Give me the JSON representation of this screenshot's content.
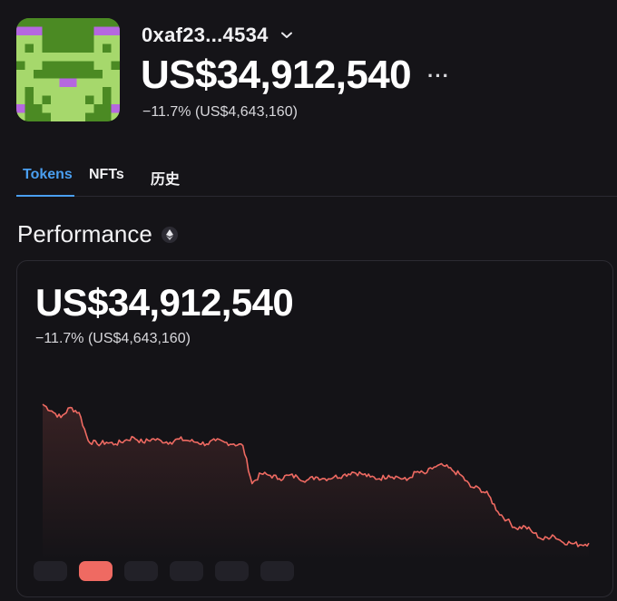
{
  "account": {
    "name": "0xaf23...4534",
    "balance": "US$34,912,540",
    "change": "−11.7% (US$4,643,160)",
    "more_label": "···"
  },
  "tabs": [
    {
      "label": "Tokens",
      "active": true
    },
    {
      "label": "NFTs",
      "active": false
    },
    {
      "label": "历史",
      "active": false
    }
  ],
  "performance": {
    "title": "Performance",
    "value": "US$34,912,540",
    "change": "−11.7% (US$4,643,160)",
    "range_buttons": [
      {
        "active": false
      },
      {
        "active": true
      },
      {
        "active": false
      },
      {
        "active": false
      },
      {
        "active": false
      },
      {
        "active": false
      }
    ]
  },
  "colors": {
    "accent": "#4a9ff0",
    "line": "#ef6a62",
    "background": "#151418",
    "avatar_green": "#4b8a23",
    "avatar_light": "#a6d86c",
    "avatar_purple": "#b567e0"
  },
  "icons": {
    "account_dropdown": "chevron-down-icon",
    "more": "more-icon",
    "network": "ethereum-icon"
  },
  "chart_data": {
    "type": "area",
    "y_unit": "relative",
    "x": [
      0,
      1,
      2,
      3,
      4,
      5,
      6,
      7,
      8,
      9,
      10,
      11,
      12,
      13,
      14,
      15,
      16,
      17,
      18,
      19,
      20,
      21,
      22,
      23,
      24,
      25,
      26,
      27,
      28,
      29,
      30,
      31,
      32,
      33,
      34,
      35,
      36,
      37,
      38,
      39,
      40,
      41,
      42,
      43,
      44,
      45,
      46,
      47,
      48,
      49,
      50,
      51,
      52,
      53,
      54,
      55,
      56,
      57,
      58,
      59,
      60
    ],
    "values": [
      100,
      96,
      92,
      98,
      95,
      78,
      76,
      77,
      76,
      78,
      80,
      77,
      79,
      78,
      77,
      79,
      78,
      77,
      76,
      78,
      77,
      76,
      75,
      52,
      58,
      57,
      55,
      57,
      56,
      54,
      56,
      55,
      56,
      57,
      59,
      58,
      56,
      55,
      57,
      56,
      54,
      59,
      58,
      62,
      63,
      60,
      57,
      50,
      49,
      45,
      35,
      30,
      25,
      26,
      22,
      18,
      21,
      17,
      16,
      15,
      16
    ],
    "grid": false,
    "legend": "none"
  }
}
